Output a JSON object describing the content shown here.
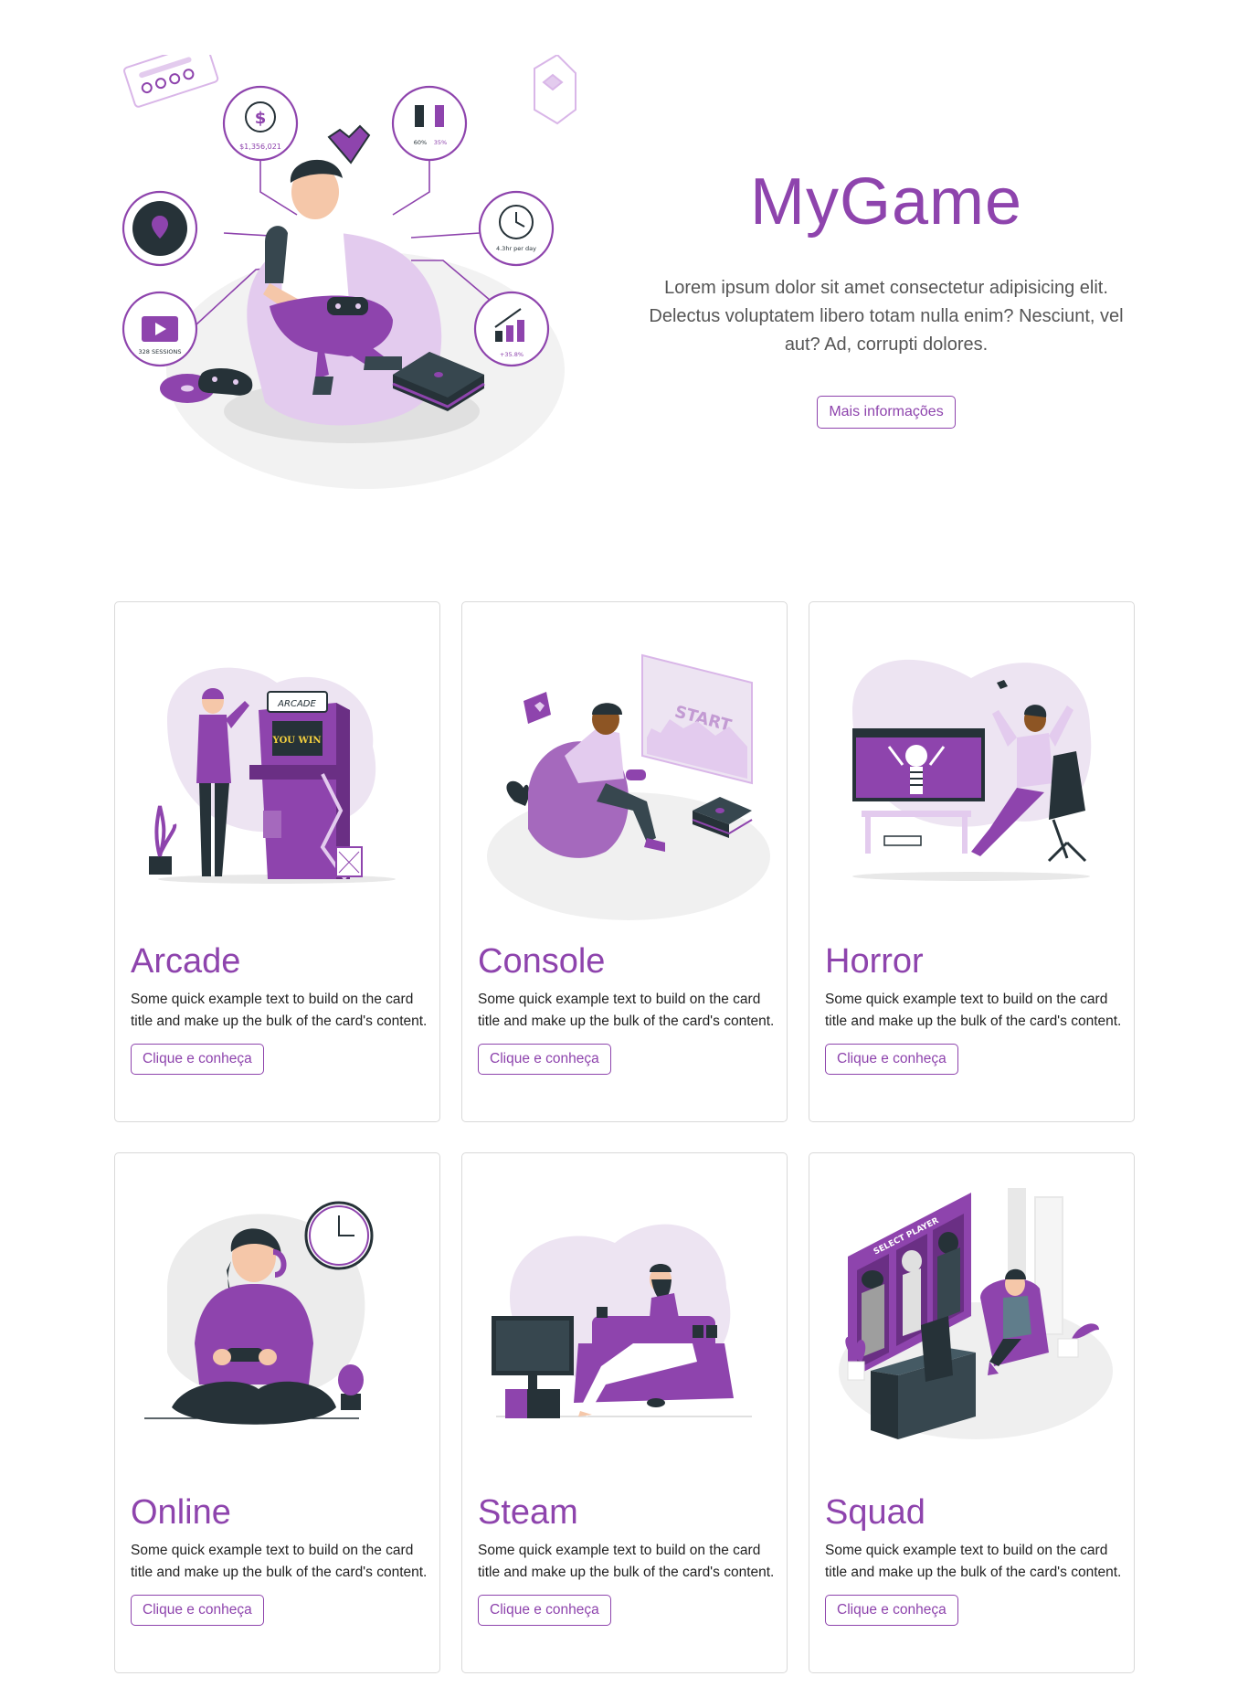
{
  "hero": {
    "title": "MyGame",
    "description": "Lorem ipsum dolor sit amet consectetur adipisicing elit. Delectus voluptatem libero totam nulla enim? Nesciunt, vel aut? Ad, corrupti dolores.",
    "button_label": "Mais informações",
    "illustration": {
      "money_value": "$1,356,021",
      "gender_male": "60%",
      "gender_female": "35%",
      "time_label": "4.3hr per day",
      "sessions_label": "328 SESSIONS",
      "growth_label": "+35.8%"
    }
  },
  "cards": [
    {
      "title": "Arcade",
      "text": "Some quick example text to build on the card title and make up the bulk of the card's content.",
      "button": "Clique e conheça",
      "illustration": {
        "sign": "ARCADE",
        "screen": "YOU WIN"
      }
    },
    {
      "title": "Console",
      "text": "Some quick example text to build on the card title and make up the bulk of the card's content.",
      "button": "Clique e conheça",
      "illustration": {
        "screen": "START"
      }
    },
    {
      "title": "Horror",
      "text": "Some quick example text to build on the card title and make up the bulk of the card's content.",
      "button": "Clique e conheça",
      "illustration": {}
    },
    {
      "title": "Online",
      "text": "Some quick example text to build on the card title and make up the bulk of the card's content.",
      "button": "Clique e conheça",
      "illustration": {}
    },
    {
      "title": "Steam",
      "text": "Some quick example text to build on the card title and make up the bulk of the card's content.",
      "button": "Clique e conheça",
      "illustration": {}
    },
    {
      "title": "Squad",
      "text": "Some quick example text to build on the card title and make up the bulk of the card's content.",
      "button": "Clique e conheça",
      "illustration": {
        "banner": "SELECT PLAYER"
      }
    }
  ],
  "colors": {
    "accent": "#8e44ad",
    "light_accent": "#e3cbee",
    "dark": "#263238",
    "blob": "#ececec"
  }
}
